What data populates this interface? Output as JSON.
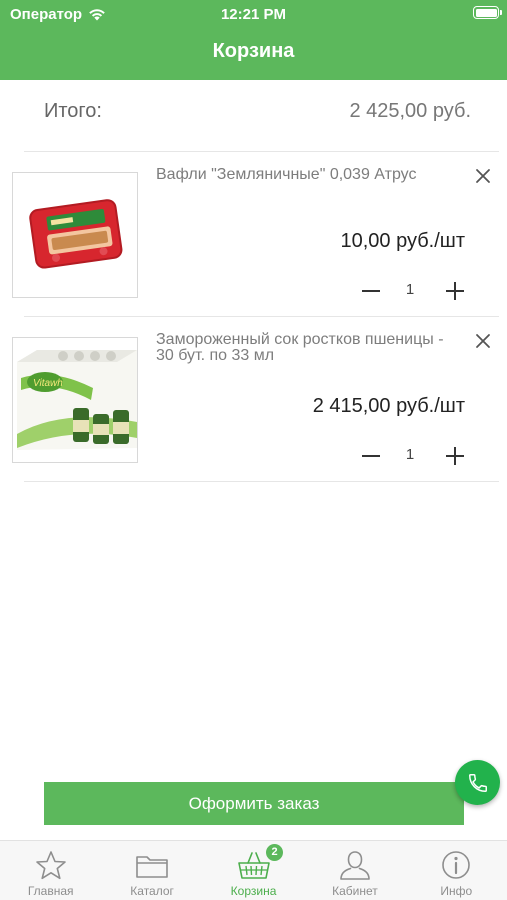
{
  "status_bar": {
    "carrier": "Оператор",
    "time": "12:21 PM"
  },
  "nav": {
    "title": "Корзина"
  },
  "cart": {
    "total_label": "Итого:",
    "total_value": "2 425,00  руб.",
    "items": [
      {
        "name": "Вафли  \"Земляничные\" 0,039 Атрус",
        "price": "10,00  руб./шт",
        "quantity": "1",
        "image": "waffles-package"
      },
      {
        "name": "Замороженный сок ростков пшеницы - 30 бут. по 33 мл",
        "price": "2 415,00  руб./шт",
        "quantity": "1",
        "image": "vitawheat-juice-box"
      }
    ]
  },
  "checkout": {
    "label": "Оформить заказ"
  },
  "tabbar": {
    "tabs": [
      {
        "label": "Главная",
        "icon": "star-icon"
      },
      {
        "label": "Каталог",
        "icon": "folder-icon"
      },
      {
        "label": "Корзина",
        "icon": "basket-icon"
      },
      {
        "label": "Кабинет",
        "icon": "user-icon"
      },
      {
        "label": "Инфо",
        "icon": "info-icon"
      }
    ],
    "badge": "2",
    "active_index": 2
  },
  "colors": {
    "brand": "#5cb85c",
    "call": "#22b24c",
    "active_tab": "#4cae4c",
    "inactive_tab": "#8e8e8e"
  }
}
